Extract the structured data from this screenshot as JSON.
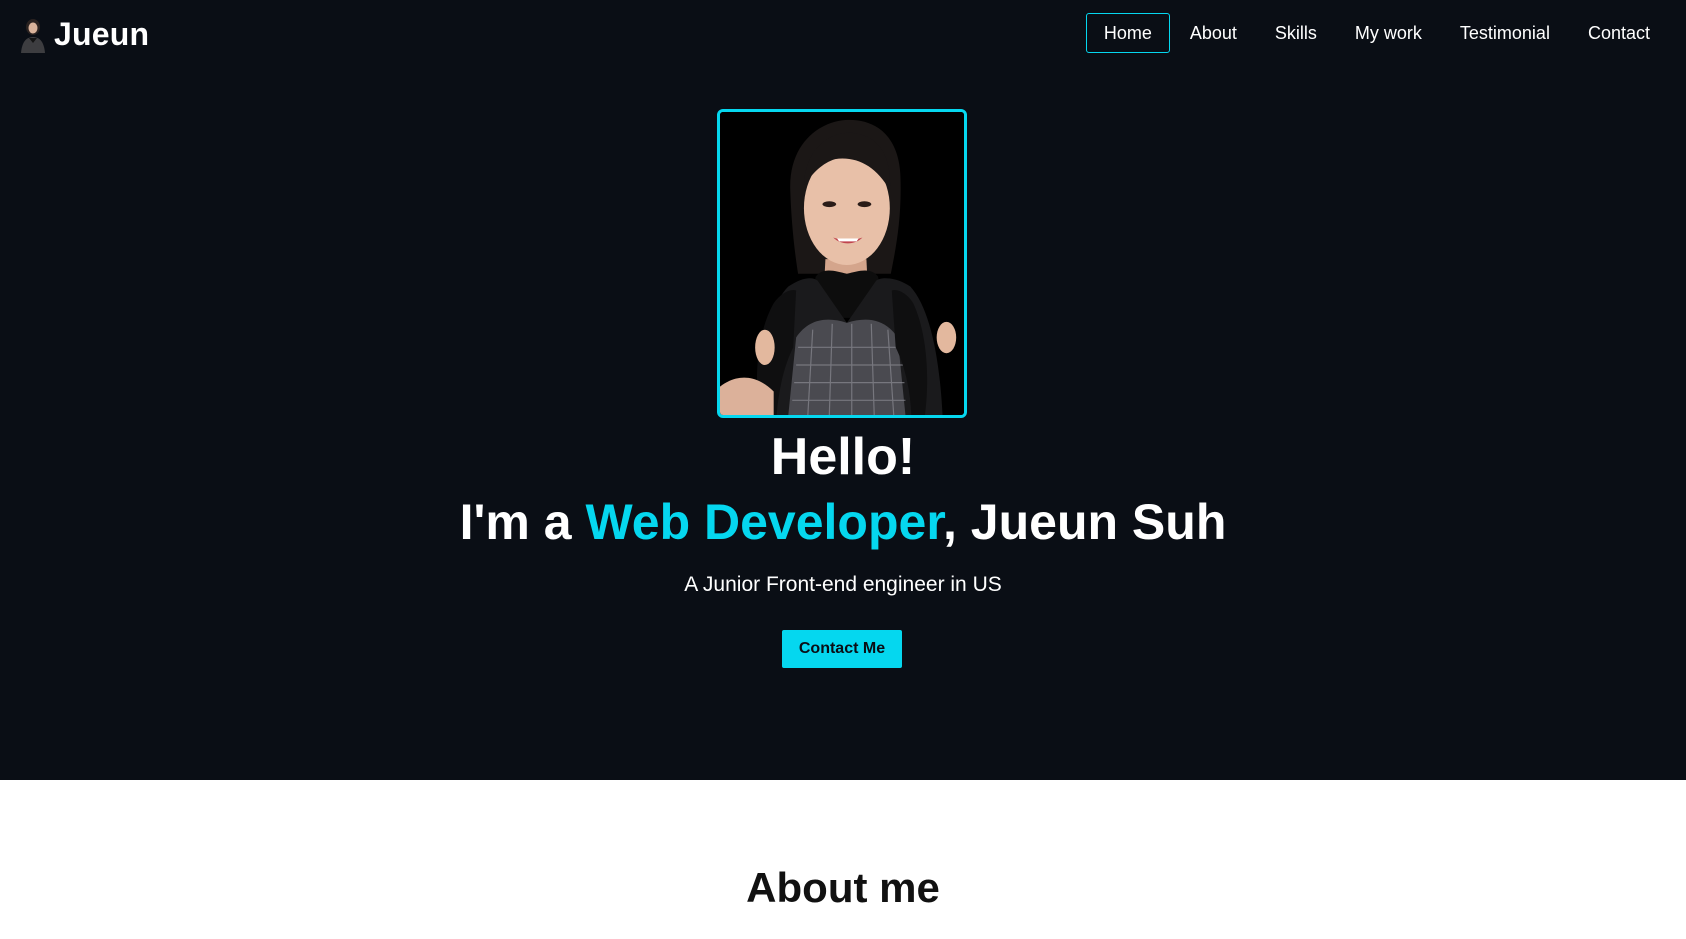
{
  "brand": {
    "name": "Jueun",
    "avatar_icon": "profile-avatar"
  },
  "nav": {
    "items": [
      {
        "label": "Home",
        "active": true
      },
      {
        "label": "About",
        "active": false
      },
      {
        "label": "Skills",
        "active": false
      },
      {
        "label": "My work",
        "active": false
      },
      {
        "label": "Testimonial",
        "active": false
      },
      {
        "label": "Contact",
        "active": false
      }
    ]
  },
  "hero": {
    "greeting": "Hello!",
    "intro_prefix": "I'm a ",
    "intro_role": "Web Developer",
    "intro_suffix": ", Jueun Suh",
    "subtitle": "A Junior Front-end engineer in US",
    "cta_label": "Contact Me"
  },
  "about": {
    "title": "About me"
  },
  "colors": {
    "background_dark": "#0a0e15",
    "accent": "#05d7ef",
    "text_light": "#ffffff",
    "section_light": "#ffffff"
  }
}
